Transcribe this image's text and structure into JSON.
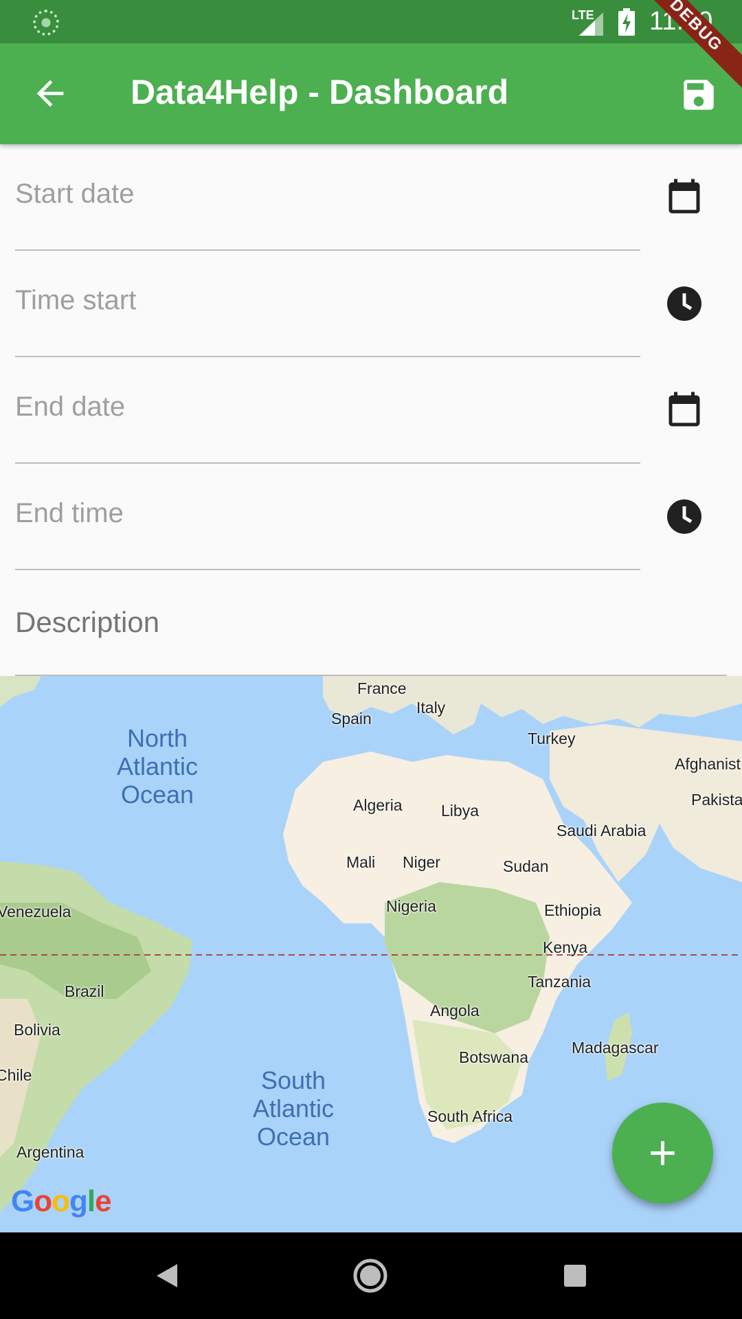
{
  "status_bar": {
    "network": "LTE",
    "time": "11:20",
    "debug_label": "DEBUG"
  },
  "app_bar": {
    "title": "Data4Help - Dashboard"
  },
  "form": {
    "start_date": {
      "placeholder": "Start date",
      "icon": "calendar-icon"
    },
    "time_start": {
      "placeholder": "Time start",
      "icon": "clock-icon"
    },
    "end_date": {
      "placeholder": "End date",
      "icon": "calendar-icon"
    },
    "end_time": {
      "placeholder": "End time",
      "icon": "clock-icon"
    },
    "description": {
      "placeholder": "Description"
    }
  },
  "map": {
    "oceans": [
      "North\nAtlantic\nOcean",
      "South\nAtlantic\nOcean"
    ],
    "countries": [
      "France",
      "Spain",
      "Italy",
      "Turkey",
      "Afghanist",
      "Pakista",
      "Algeria",
      "Libya",
      "Saudi Arabia",
      "Mali",
      "Niger",
      "Sudan",
      "Venezuela",
      "Nigeria",
      "Ethiopia",
      "Kenya",
      "Tanzania",
      "Brazil",
      "Angola",
      "Bolivia",
      "Botswana",
      "Madagascar",
      "Chile",
      "South Africa",
      "Argentina"
    ],
    "attribution": "Google"
  },
  "fab": {
    "icon": "plus-icon"
  },
  "nav_bar": {
    "buttons": [
      "back",
      "home",
      "recents"
    ]
  }
}
